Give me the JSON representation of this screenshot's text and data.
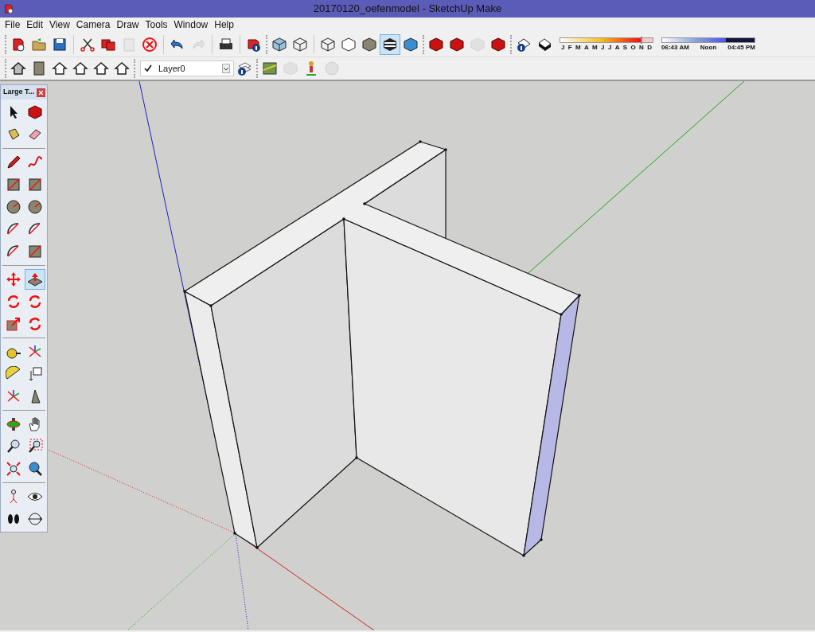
{
  "window": {
    "title": "20170120_oefenmodel - SketchUp Make"
  },
  "menu": [
    "File",
    "Edit",
    "View",
    "Camera",
    "Draw",
    "Tools",
    "Window",
    "Help"
  ],
  "standard_toolbar": [
    {
      "disabled": false
    },
    {
      "disabled": false
    },
    {
      "disabled": false
    },
    {
      "disabled": false
    },
    {
      "disabled": false
    },
    {
      "disabled": true
    },
    {
      "disabled": false
    },
    {
      "disabled": false
    },
    {
      "disabled": true
    },
    {
      "disabled": false
    },
    {
      "disabled": false
    }
  ],
  "face_style_buttons": [
    {
      "selected": false
    },
    {
      "selected": false
    },
    {
      "selected": false
    },
    {
      "selected": false
    },
    {
      "selected": false
    },
    {
      "selected": true
    },
    {
      "selected": false
    }
  ],
  "warehouse_toolbar": [
    {
      "disabled": false
    },
    {
      "disabled": false
    },
    {
      "disabled": true
    },
    {
      "disabled": false
    }
  ],
  "month_slider": {
    "level": 0.87,
    "labels": [
      "J",
      "F",
      "M",
      "A",
      "M",
      "J",
      "J",
      "A",
      "S",
      "O",
      "N",
      "D"
    ]
  },
  "time_slider": {
    "level": 0.69,
    "start": "06:43 AM",
    "middle": "Noon",
    "end": "04:45 PM"
  },
  "layer": {
    "value": "Layer0"
  },
  "location_toolbar": [
    {
      "disabled": false
    },
    {
      "disabled": true
    },
    {
      "disabled": false
    },
    {
      "disabled": true
    }
  ],
  "tool_palette": {
    "title": "Large T...",
    "tools": [
      {
        "selected": false
      },
      {
        "selected": false
      },
      {
        "selected": false
      },
      {
        "selected": false
      },
      {
        "selected": false
      },
      {
        "selected": false
      },
      {
        "selected": false
      },
      {
        "selected": false
      },
      {
        "selected": false
      },
      {
        "selected": false
      },
      {
        "selected": false
      },
      {
        "selected": false
      },
      {
        "selected": false
      },
      {
        "selected": false
      },
      {
        "selected": false
      },
      {
        "selected": true
      },
      {
        "selected": false
      },
      {
        "selected": false
      },
      {
        "selected": false
      },
      {
        "selected": false
      },
      {
        "selected": false
      },
      {
        "selected": false
      },
      {
        "selected": false
      },
      {
        "selected": false
      },
      {
        "selected": false
      },
      {
        "selected": false
      },
      {
        "selected": false
      },
      {
        "selected": false
      },
      {
        "selected": false
      },
      {
        "selected": false
      },
      {
        "selected": false
      },
      {
        "selected": false
      },
      {
        "selected": false
      },
      {
        "selected": false
      },
      {
        "selected": false
      },
      {
        "selected": false
      }
    ]
  }
}
